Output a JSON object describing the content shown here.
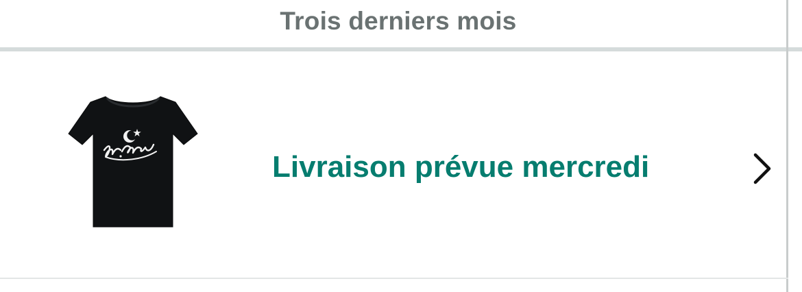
{
  "section": {
    "title": "Trois derniers mois"
  },
  "order": {
    "status": "Livraison prévue mercredi",
    "product_image": "black-tshirt-crescent-star-signature",
    "chevron_icon": "chevron-right-icon"
  },
  "colors": {
    "section_title": "#6a7272",
    "status_text": "#067d6f",
    "divider": "#d5dbdb"
  }
}
